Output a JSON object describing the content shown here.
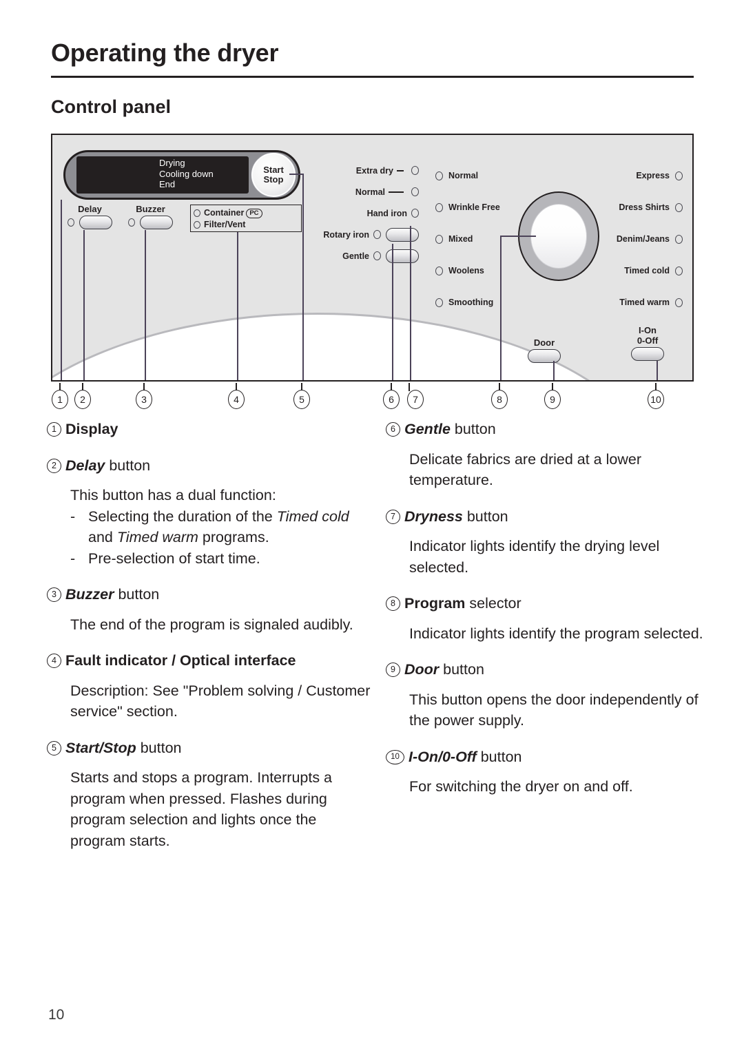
{
  "document": {
    "chapter_title": "Operating the dryer",
    "section_title": "Control panel",
    "page_number": "10"
  },
  "control_panel": {
    "display": {
      "screen_lines": [
        "Drying",
        "Cooling down",
        "End"
      ],
      "start_stop_line1": "Start",
      "start_stop_line2": "Stop"
    },
    "option_buttons": [
      {
        "label": "Delay",
        "lamp": "indicator-lamp",
        "button": "push-button"
      },
      {
        "label": "Buzzer",
        "lamp": "indicator-lamp",
        "button": "push-button"
      }
    ],
    "status_box": {
      "items": [
        {
          "label": "Container",
          "badge": "PC"
        },
        {
          "label": "Filter/Vent",
          "badge": ""
        }
      ]
    },
    "dryness_levels": [
      {
        "label": "Extra dry",
        "dash": "short",
        "has_button": false
      },
      {
        "label": "Normal",
        "dash": "long",
        "has_button": false
      },
      {
        "label": "Hand iron",
        "dash": "none",
        "has_button": false
      },
      {
        "label": "Rotary iron",
        "dash": "none",
        "has_button": true
      },
      {
        "label": "Gentle",
        "dash": "none",
        "has_button": true
      }
    ],
    "programs_center": [
      "Normal",
      "Wrinkle Free",
      "Mixed",
      "Woolens",
      "Smoothing"
    ],
    "programs_right": [
      "Express",
      "Dress Shirts",
      "Denim/Jeans",
      "Timed cold",
      "Timed warm"
    ],
    "door_button": {
      "label": "Door"
    },
    "power_button": {
      "label_line1": "I-On",
      "label_line2": "0-Off"
    },
    "callout_numbers": [
      "1",
      "2",
      "3",
      "4",
      "5",
      "6",
      "7",
      "8",
      "9",
      "10"
    ]
  },
  "legend": {
    "left_column": [
      {
        "number": "1",
        "name": "Display",
        "name_style": "bold",
        "suffix": "",
        "body": []
      },
      {
        "number": "2",
        "name": "Delay",
        "name_style": "bold-italic",
        "suffix": " button",
        "body": [
          {
            "kind": "para",
            "text": "This button has a dual function:"
          },
          {
            "kind": "dash",
            "text": "Selecting the duration of the Timed cold and Timed warm programs.",
            "italic_parts": [
              "Timed cold",
              "Timed warm"
            ]
          },
          {
            "kind": "dash",
            "text": "Pre-selection of start time.",
            "italic_parts": []
          }
        ]
      },
      {
        "number": "3",
        "name": "Buzzer",
        "name_style": "bold-italic",
        "suffix": " button",
        "body": [
          {
            "kind": "para",
            "text": "The end of the program is signaled audibly."
          }
        ]
      },
      {
        "number": "4",
        "name": "Fault indicator / Optical interface",
        "name_style": "bold",
        "suffix": "",
        "body": [
          {
            "kind": "para",
            "text": "Description: See \"Problem solving / Customer service\" section."
          }
        ]
      },
      {
        "number": "5",
        "name": "Start/Stop",
        "name_style": "bold-italic",
        "suffix": " button",
        "body": [
          {
            "kind": "para",
            "text": "Starts and stops a program. Interrupts a program when pressed. Flashes during program selection and lights once the program starts."
          }
        ]
      }
    ],
    "right_column": [
      {
        "number": "6",
        "name": "Gentle",
        "name_style": "bold-italic",
        "suffix": " button",
        "body": [
          {
            "kind": "para",
            "text": "Delicate fabrics are dried at a lower temperature."
          }
        ]
      },
      {
        "number": "7",
        "name": "Dryness",
        "name_style": "bold-italic",
        "suffix": " button",
        "body": [
          {
            "kind": "para",
            "text": "Indicator lights identify the drying level selected."
          }
        ]
      },
      {
        "number": "8",
        "name": "Program",
        "name_style": "bold",
        "suffix": " selector",
        "body": [
          {
            "kind": "para",
            "text": "Indicator lights identify the program selected."
          }
        ]
      },
      {
        "number": "9",
        "name": "Door",
        "name_style": "bold-italic",
        "suffix": " button",
        "body": [
          {
            "kind": "para",
            "text": "This button opens the door independently of the power supply."
          }
        ]
      },
      {
        "number": "10",
        "name": "I-On/0-Off",
        "name_style": "bold-italic",
        "suffix": " button",
        "body": [
          {
            "kind": "para",
            "text": "For switching the dryer on and off."
          }
        ]
      }
    ]
  },
  "colors": {
    "panel_background": "#e4e4e4",
    "display_screen": "#231f20",
    "leader_line": "#4b4258",
    "text": "#231f20"
  }
}
